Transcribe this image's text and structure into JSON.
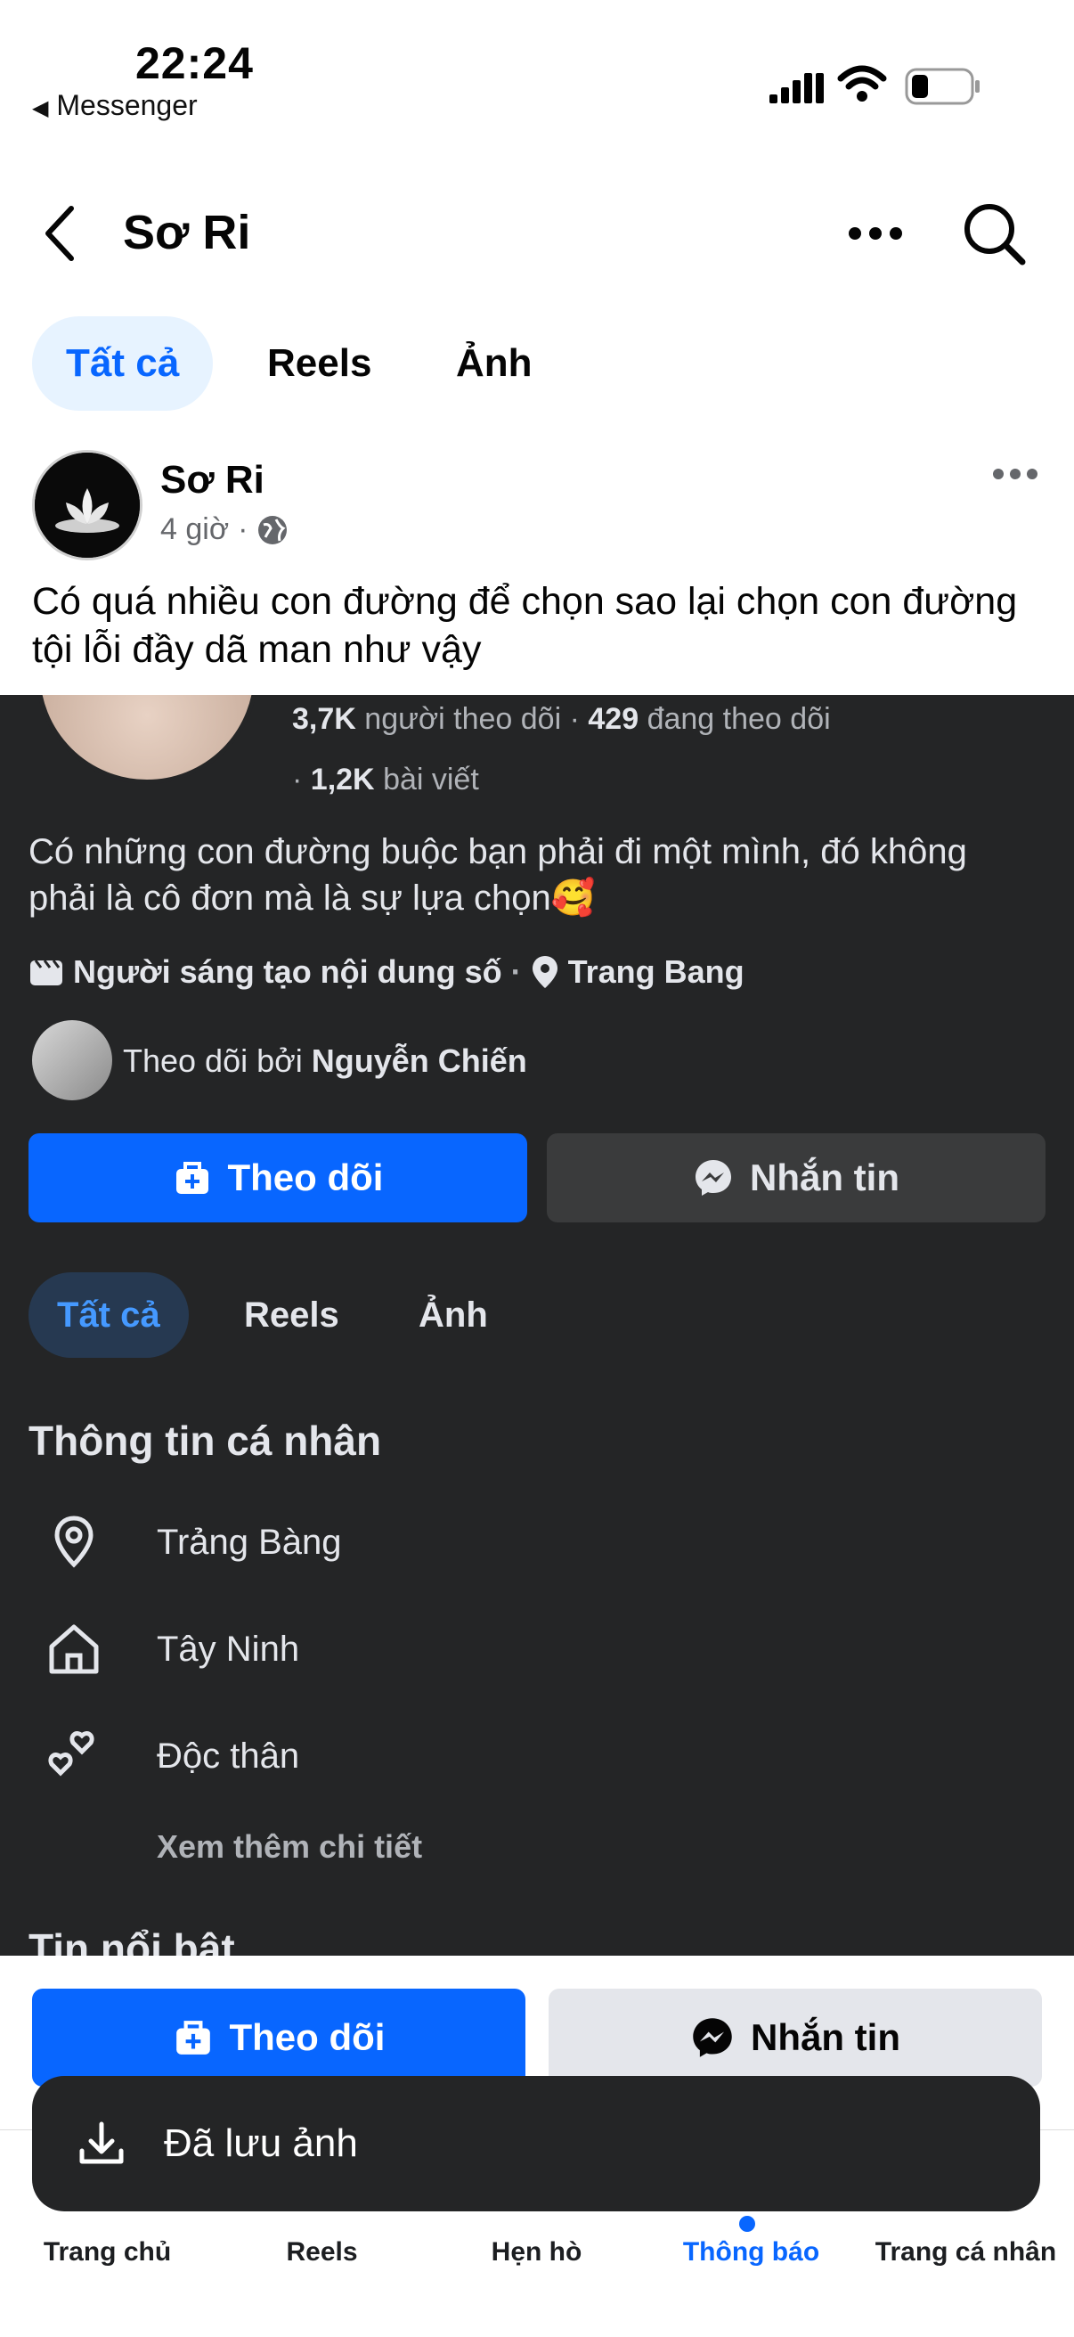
{
  "status_bar": {
    "time": "22:24",
    "back_app": "Messenger"
  },
  "header": {
    "title": "Sơ Ri"
  },
  "tabs": [
    {
      "label": "Tất cả"
    },
    {
      "label": "Reels"
    },
    {
      "label": "Ảnh"
    }
  ],
  "post": {
    "author": "Sơ Ri",
    "time": "4 giờ",
    "text": "Có quá nhiều con đường để chọn sao lại chọn con đường tội lỗi đầy dã man như vậy"
  },
  "screenshot": {
    "followers_count": "3,7K",
    "followers_label": "người theo dõi",
    "following_count": "429",
    "following_label": "đang theo dõi",
    "posts_count": "1,2K",
    "posts_label": "bài viết",
    "bio": "Có những con đường buộc bạn phải đi một mình, đó không phải là cô đơn mà là sự lựa chọn🥰",
    "creator_label": "Người sáng tạo nội dung số",
    "location": "Trang Bang",
    "followed_by_prefix": "Theo dõi bởi",
    "followed_by_name": "Nguyễn Chiến",
    "follow_button": "Theo dõi",
    "message_button": "Nhắn tin",
    "tabs": [
      {
        "label": "Tất cả"
      },
      {
        "label": "Reels"
      },
      {
        "label": "Ảnh"
      }
    ],
    "info_title": "Thông tin cá nhân",
    "info": [
      {
        "icon": "location-pin-icon",
        "text": "Trảng Bàng"
      },
      {
        "icon": "home-icon",
        "text": "Tây Ninh"
      },
      {
        "icon": "hearts-icon",
        "text": "Độc thân"
      }
    ],
    "more_detail": "Xem thêm chi tiết",
    "featured_partial": "Tin nổi bật"
  },
  "bottom_actions": {
    "follow": "Theo dõi",
    "message": "Nhắn tin"
  },
  "toast": {
    "text": "Đã lưu ảnh"
  },
  "nav": [
    {
      "label": "Trang chủ"
    },
    {
      "label": "Reels"
    },
    {
      "label": "Hẹn hò"
    },
    {
      "label": "Thông báo"
    },
    {
      "label": "Trang cá nhân"
    }
  ],
  "colors": {
    "accent": "#0866ff",
    "dark_bg": "#242526"
  }
}
